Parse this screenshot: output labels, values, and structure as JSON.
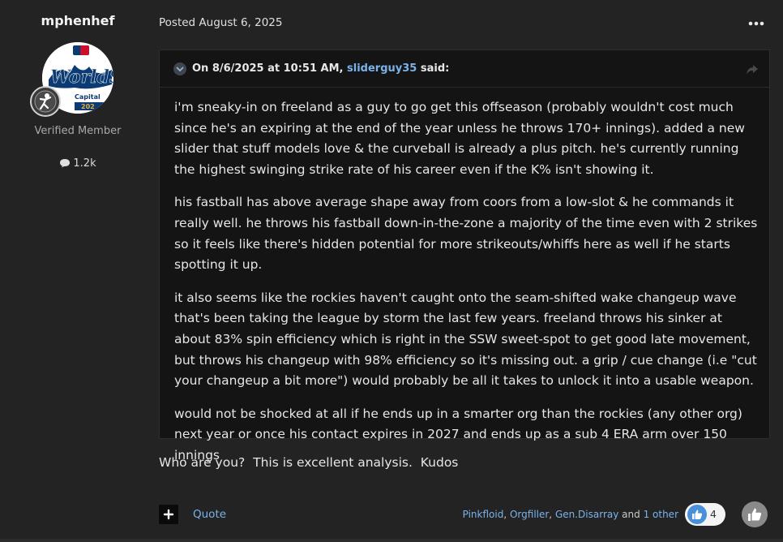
{
  "author": {
    "name": "mphenhef",
    "avatar_icon": "world-series-logo",
    "badge_icon": "baseball-player-badge",
    "group": "Verified Member",
    "post_count": "1.2k",
    "post_count_icon": "speech-bubble-icon"
  },
  "post": {
    "posted_label": "Posted August 6, 2025",
    "menu_icon": "more-horizontal-icon"
  },
  "quote": {
    "prefix": "On 8/6/2025 at 10:51 AM,",
    "quoted_user": "sliderguy35",
    "suffix": "said:",
    "paragraphs": [
      "i'm sneaky-in on freeland as a guy to go get this offseason (probably wouldn't cost much since he's an expiring at the end of the year unless he throws 170+ innings). added a new slider that stuff models love & the curveball is already a plus pitch. he's currently running the highest swinging strike rate of his career even if the K% isn't showing it.",
      "his fastball has above average shape away from coors from a low-slot & he commands it really well. he throws his fastball down-in-the-zone a majority of the time even with 2 strikes so it feels like there's hidden potential for more strikeouts/whiffs here as well if he starts spotting it up.",
      "it also seems like the rockies haven't caught onto the seam-shifted wake changeup wave that's been taking the league by storm the last few years. freeland throws his sinker at about 83% spin efficiency which is right in the SSW sweet-spot to get good late movement, but throws his changeup with 98% efficiency so it's missing out. a grip / cue change (i.e \"cut your changeup a bit more\") would probably be all it takes to unlock it into a usable weapon.",
      "would not be shocked at all if he ends up in a smarter org than the rockies (any other org) next year or once his contact expires in 2027 and ends up as a sub 4 ERA arm over 150 innings"
    ]
  },
  "reply": {
    "text": "Who are you?  This is excellent analysis.  Kudos"
  },
  "footer": {
    "quote_label": "Quote",
    "reactors": [
      "Pinkfloid",
      "Orgfiller",
      "Gen.Disarray"
    ],
    "reactors_and": "and",
    "reactors_more": "1 other",
    "reaction_count": "4",
    "reaction_icon": "thumbs-up-icon",
    "accent_color": "#7ab3ea"
  }
}
